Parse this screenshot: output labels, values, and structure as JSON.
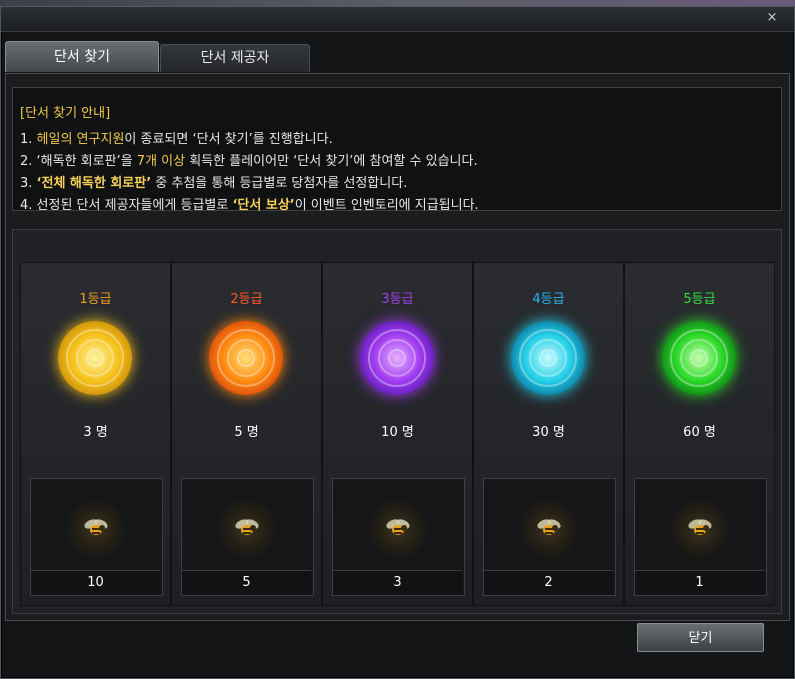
{
  "window": {
    "close_label": "×"
  },
  "tabs": [
    {
      "label": "단서 찾기",
      "active": true
    },
    {
      "label": "단서 제공자",
      "active": false
    }
  ],
  "info": {
    "title": "[단서 찾기 안내]",
    "lines": [
      [
        {
          "t": "1. ",
          "c": "normal"
        },
        {
          "t": "헤일의 연구지원",
          "c": "hl"
        },
        {
          "t": "이 종료되면 ‘단서 찾기’를 진행합니다.",
          "c": "normal"
        }
      ],
      [
        {
          "t": "2. ‘해독한 회로판’을 ",
          "c": "normal"
        },
        {
          "t": "7개 이상",
          "c": "hl"
        },
        {
          "t": " 획득한 플레이어만 ‘단서 찾기’에 참여할 수 있습니다.",
          "c": "normal"
        }
      ],
      [
        {
          "t": "3. ",
          "c": "normal"
        },
        {
          "t": "‘전체 해독한 회로판’",
          "c": "hlb"
        },
        {
          "t": " 중 추첨을 통해 등급별로 당첨자를 선정합니다.",
          "c": "normal"
        }
      ],
      [
        {
          "t": "4. 선정된 단서 제공자들에게 등급별로 ",
          "c": "normal"
        },
        {
          "t": "‘단서 보상’",
          "c": "hlb"
        },
        {
          "t": "이 이벤트 인벤토리에 지급됩니다.",
          "c": "normal"
        }
      ]
    ]
  },
  "grades": [
    {
      "label": "1등급",
      "color": "#f0a020",
      "orb": [
        "#fff3a0",
        "#f5c21a",
        "#c98a08"
      ],
      "count": "3 명",
      "reward_qty": "10",
      "reward_icon": "bee-icon"
    },
    {
      "label": "2등급",
      "color": "#ff5a28",
      "orb": [
        "#ffe27a",
        "#ff8a10",
        "#d8420a"
      ],
      "count": "5 명",
      "reward_qty": "5",
      "reward_icon": "bee-icon"
    },
    {
      "label": "3등급",
      "color": "#a040f0",
      "orb": [
        "#e8b0ff",
        "#a03cf0",
        "#5a18b0"
      ],
      "count": "10 명",
      "reward_qty": "3",
      "reward_icon": "bee-icon"
    },
    {
      "label": "4등급",
      "color": "#22b4f0",
      "orb": [
        "#c8fbff",
        "#22cfe6",
        "#0a6e9a"
      ],
      "count": "30 명",
      "reward_qty": "2",
      "reward_icon": "bee-icon"
    },
    {
      "label": "5등급",
      "color": "#30e040",
      "orb": [
        "#c8ffb0",
        "#2ad828",
        "#0a7a14"
      ],
      "count": "60 명",
      "reward_qty": "1",
      "reward_icon": "bee-icon"
    }
  ],
  "footer": {
    "confirm_label": "닫기"
  }
}
